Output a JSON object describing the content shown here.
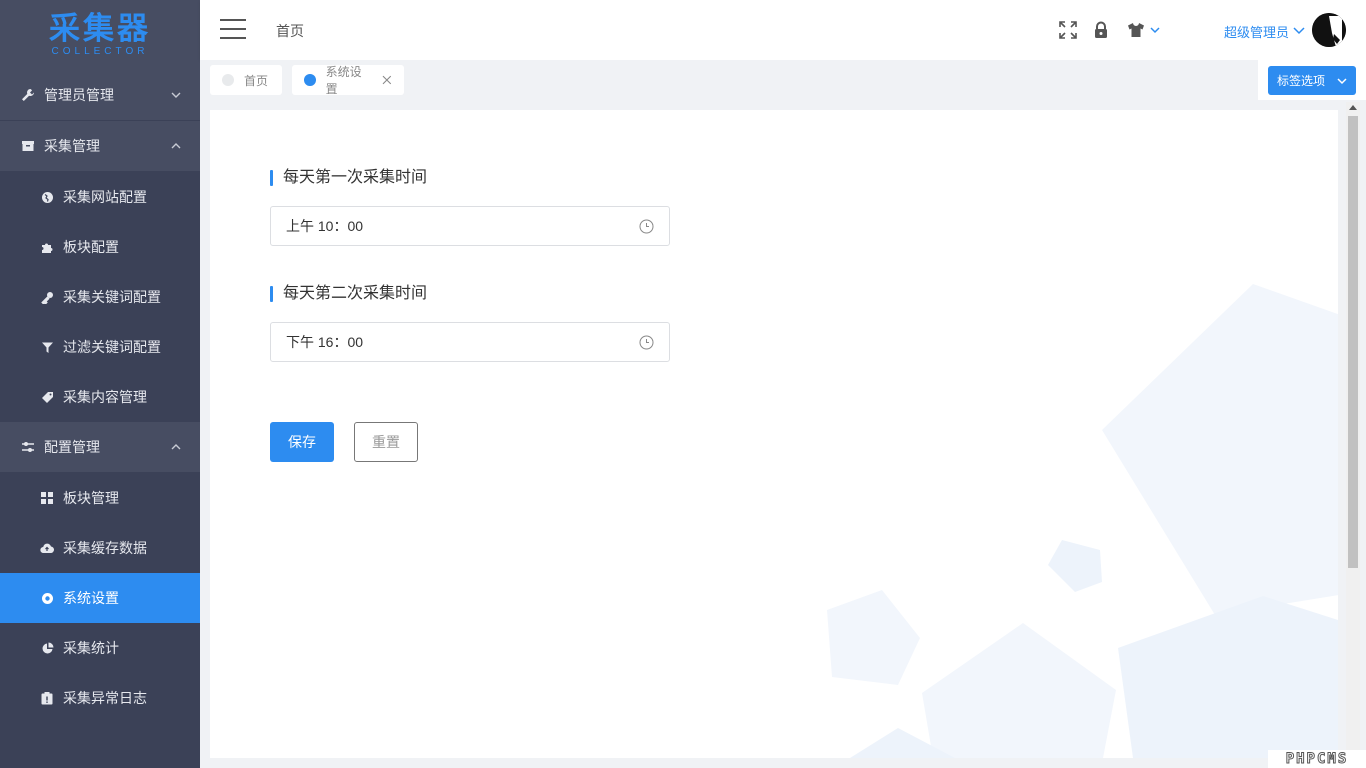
{
  "logo": {
    "title": "采集器",
    "subtitle": "COLLECTOR"
  },
  "sidebar": {
    "groups": [
      {
        "label": "管理员管理",
        "icon": "wrench-icon",
        "expanded": false,
        "items": []
      },
      {
        "label": "采集管理",
        "icon": "box-icon",
        "expanded": true,
        "items": [
          {
            "label": "采集网站配置",
            "icon": "globe-icon"
          },
          {
            "label": "板块配置",
            "icon": "puzzle-icon"
          },
          {
            "label": "采集关键词配置",
            "icon": "key-icon"
          },
          {
            "label": "过滤关键词配置",
            "icon": "filter-icon"
          },
          {
            "label": "采集内容管理",
            "icon": "tag-icon"
          }
        ]
      },
      {
        "label": "配置管理",
        "icon": "sliders-icon",
        "expanded": true,
        "items": [
          {
            "label": "板块管理",
            "icon": "grid-icon"
          },
          {
            "label": "采集缓存数据",
            "icon": "cloud-upload-icon"
          },
          {
            "label": "系统设置",
            "icon": "settings-icon",
            "active": true
          },
          {
            "label": "采集统计",
            "icon": "pie-chart-icon"
          },
          {
            "label": "采集异常日志",
            "icon": "clipboard-icon"
          }
        ]
      }
    ]
  },
  "header": {
    "breadcrumb": "首页",
    "user_name": "超级管理员"
  },
  "tabs": {
    "items": [
      {
        "label": "首页",
        "active": false
      },
      {
        "label": "系统设置",
        "active": true
      }
    ],
    "options_label": "标签选项"
  },
  "form": {
    "first_label": "每天第一次采集时间",
    "first_value": "上午 10：00",
    "second_label": "每天第二次采集时间",
    "second_value": "下午 16：00",
    "save_label": "保存",
    "reset_label": "重置"
  },
  "watermark": "PHPCMS",
  "colors": {
    "accent": "#2d8cf0",
    "sidebar_bg": "#3b4157",
    "sidebar_group_bg": "#474d62"
  }
}
